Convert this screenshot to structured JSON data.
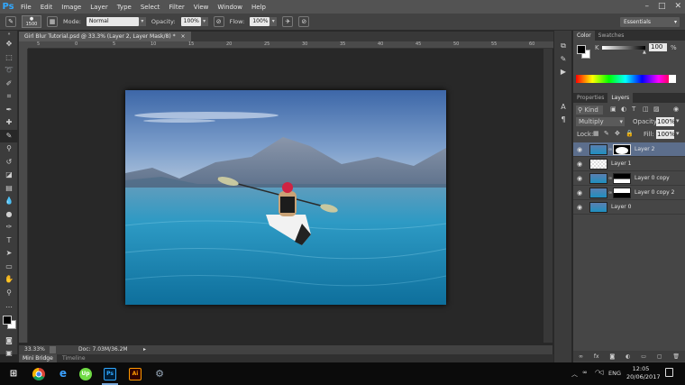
{
  "menu": {
    "logo": "Ps",
    "items": [
      "File",
      "Edit",
      "Image",
      "Layer",
      "Type",
      "Select",
      "Filter",
      "View",
      "Window",
      "Help"
    ],
    "window_controls": [
      "–",
      "□",
      "✕"
    ]
  },
  "options": {
    "brush_size": "1500",
    "mode_label": "Mode:",
    "mode_value": "Normal",
    "opacity_label": "Opacity:",
    "opacity_value": "100%",
    "flow_label": "Flow:",
    "flow_value": "100%",
    "workspace": "Essentials"
  },
  "document": {
    "tab_title": "Girl Blur Tutorial.psd @ 33.3% (Layer 2, Layer Mask/8) *",
    "ruler_ticks": [
      "5",
      "0",
      "5",
      "10",
      "15",
      "20",
      "25",
      "30",
      "35",
      "40",
      "45",
      "50",
      "55",
      "60"
    ],
    "zoom": "33.33%",
    "doc_info": "Doc: 7.03M/36.2M"
  },
  "bottom_tabs": {
    "mini_bridge": "Mini Bridge",
    "timeline": "Timeline"
  },
  "color_panel": {
    "tabs": [
      "Color",
      "Swatches"
    ],
    "channel": "K",
    "value": "100",
    "unit": "%"
  },
  "layers_panel": {
    "tabs": [
      "Properties",
      "Layers"
    ],
    "filter": "Kind",
    "blend_mode": "Multiply",
    "opacity_label": "Opacity:",
    "opacity_value": "100%",
    "lock_label": "Lock:",
    "fill_label": "Fill:",
    "fill_value": "100%",
    "layers": [
      {
        "name": "Layer 2",
        "selected": true
      },
      {
        "name": "Layer 1",
        "selected": false
      },
      {
        "name": "Layer 0 copy",
        "selected": false
      },
      {
        "name": "Layer 0 copy 2",
        "selected": false
      },
      {
        "name": "Layer 0",
        "selected": false
      }
    ],
    "footer_icons": [
      "link-icon",
      "fx-icon",
      "mask-icon",
      "adjustment-icon",
      "group-icon",
      "new-layer-icon",
      "trash-icon"
    ]
  },
  "taskbar": {
    "apps": [
      "windows-start-icon",
      "chrome-icon",
      "edge-icon",
      "upwork-icon",
      "photoshop-icon",
      "illustrator-icon",
      "steam-icon"
    ],
    "lang": "ENG",
    "time": "12:05",
    "date": "20/06/2017",
    "ps_label": "Ps",
    "ai_label": "Ai",
    "up_label": "Up"
  },
  "colors": {
    "accent": "#31a8ff",
    "selected_layer": "#5c6e8c",
    "foreground": "#000000",
    "background": "#ffffff"
  }
}
